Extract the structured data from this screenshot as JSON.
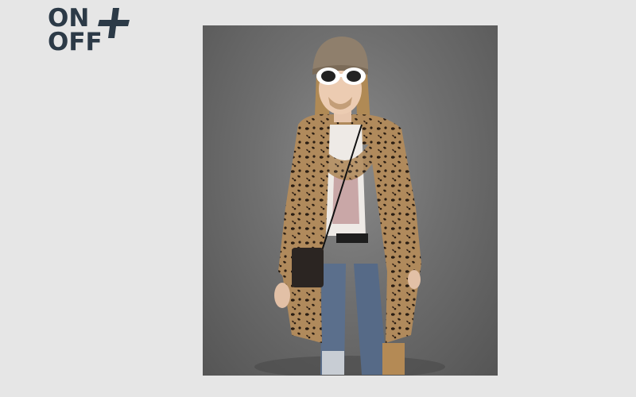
{
  "brand": {
    "logo_line_1": "ON",
    "logo_line_2": "OFF",
    "logo_symbol": "plus-icon",
    "color": "#2c3a47"
  },
  "page": {
    "background": "#e6e6e6"
  },
  "photo": {
    "background": "#6f6f6f"
  }
}
